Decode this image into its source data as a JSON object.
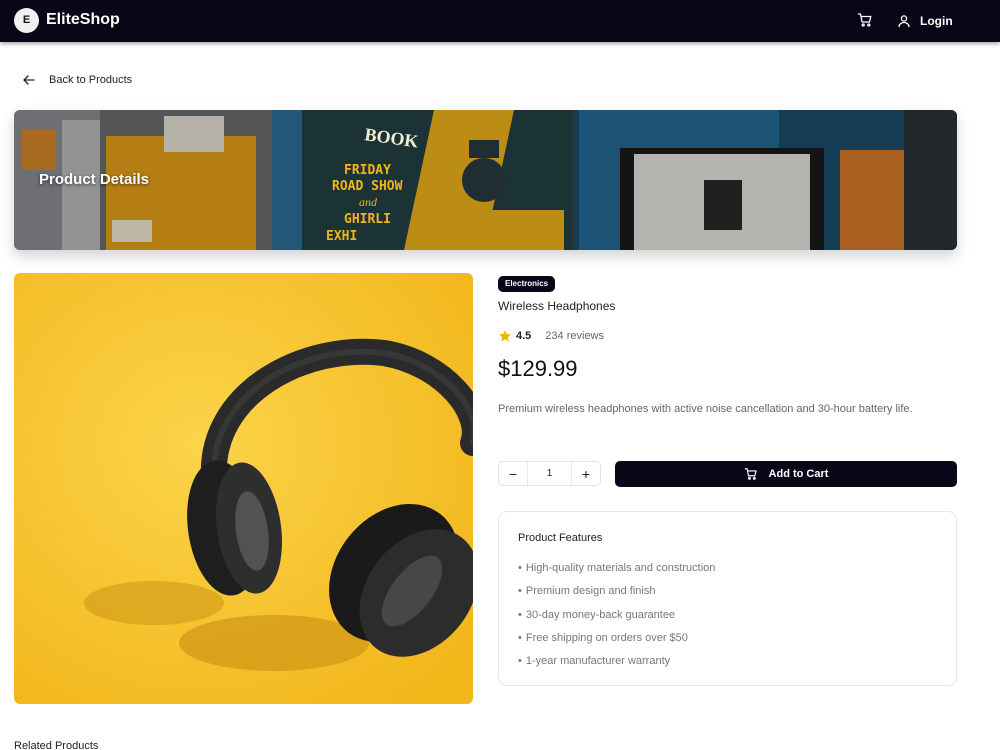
{
  "navbar": {
    "logo_letter": "E",
    "brand": "EliteShop",
    "cart_icon": "cart-icon",
    "login_icon": "user-icon",
    "login_label": "Login"
  },
  "back": {
    "icon": "arrow-left-icon",
    "label": "Back to Products"
  },
  "hero": {
    "title": "Product Details",
    "image_text": [
      "BOOK",
      "FRIDAY",
      "ROAD SHOW",
      "and",
      "GHIRLI",
      "EXHI"
    ]
  },
  "product": {
    "category": "Electronics",
    "name": "Wireless Headphones",
    "rating": "4.5",
    "reviews": "234 reviews",
    "price": "$129.99",
    "description": "Premium wireless headphones with active noise cancellation and 30-hour battery life."
  },
  "quantity": {
    "minus": "−",
    "value": "1",
    "plus": "+"
  },
  "cart_button": {
    "icon": "cart-icon",
    "label": "Add to Cart"
  },
  "features": {
    "title": "Product Features",
    "bullet": "•",
    "items": [
      "High-quality materials and construction",
      "Premium design and finish",
      "30-day money-back guarantee",
      "Free shipping on orders over $50",
      "1-year manufacturer warranty"
    ]
  },
  "related": {
    "title": "Related Products"
  },
  "colors": {
    "nav_bg": "#070718",
    "accent_yellow": "#f5c32c",
    "star": "#f4b400"
  }
}
